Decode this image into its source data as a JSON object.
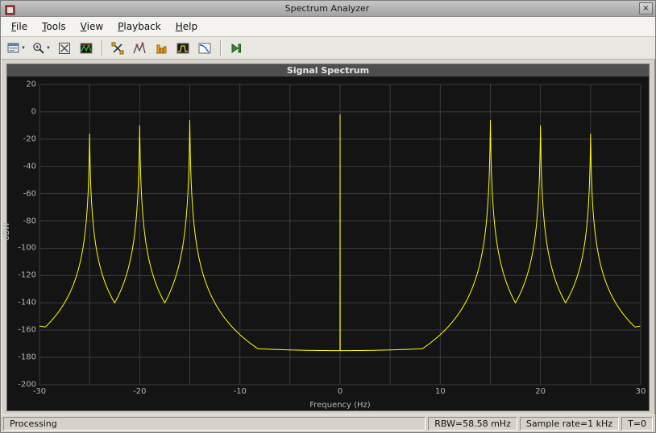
{
  "window": {
    "title": "Spectrum Analyzer",
    "close_glyph": "×"
  },
  "menu": {
    "items": [
      {
        "label": "File",
        "mnemonic": "F"
      },
      {
        "label": "Tools",
        "mnemonic": "T"
      },
      {
        "label": "View",
        "mnemonic": "V"
      },
      {
        "label": "Playback",
        "mnemonic": "P"
      },
      {
        "label": "Help",
        "mnemonic": "H"
      }
    ]
  },
  "toolbar": {
    "dropdown_glyph": "▼"
  },
  "chart_data": {
    "type": "line",
    "title": "Signal Spectrum",
    "xlabel": "Frequency (Hz)",
    "ylabel": "dBW",
    "xlim": [
      -30,
      30
    ],
    "ylim": [
      -200,
      20
    ],
    "xticks": [
      -30,
      -20,
      -10,
      0,
      10,
      20,
      30
    ],
    "yticks": [
      20,
      0,
      -20,
      -40,
      -60,
      -80,
      -100,
      -120,
      -140,
      -160,
      -180,
      -200
    ],
    "x_grid_step_hz": 5,
    "grid_on": true,
    "grid_color": "#3c3c3c",
    "trace_color": "#ffff00",
    "background_color": "#141414",
    "noise_floor": {
      "center_dbw": -175,
      "edge_dbw": -157
    },
    "valley_between_peaks_dbw": -140,
    "peak_skirt_width_hz": 0.05,
    "dc_skirt_steepness": 2600,
    "peaks": [
      {
        "freq": -25,
        "dbw": -16
      },
      {
        "freq": -20,
        "dbw": -10
      },
      {
        "freq": -15,
        "dbw": -6
      },
      {
        "freq": 0,
        "dbw": -2
      },
      {
        "freq": 15,
        "dbw": -6
      },
      {
        "freq": 20,
        "dbw": -10
      },
      {
        "freq": 25,
        "dbw": -16
      }
    ]
  },
  "status": {
    "left": "Processing",
    "segments": [
      "RBW=58.58 mHz",
      "Sample rate=1 kHz",
      "T=0"
    ]
  }
}
